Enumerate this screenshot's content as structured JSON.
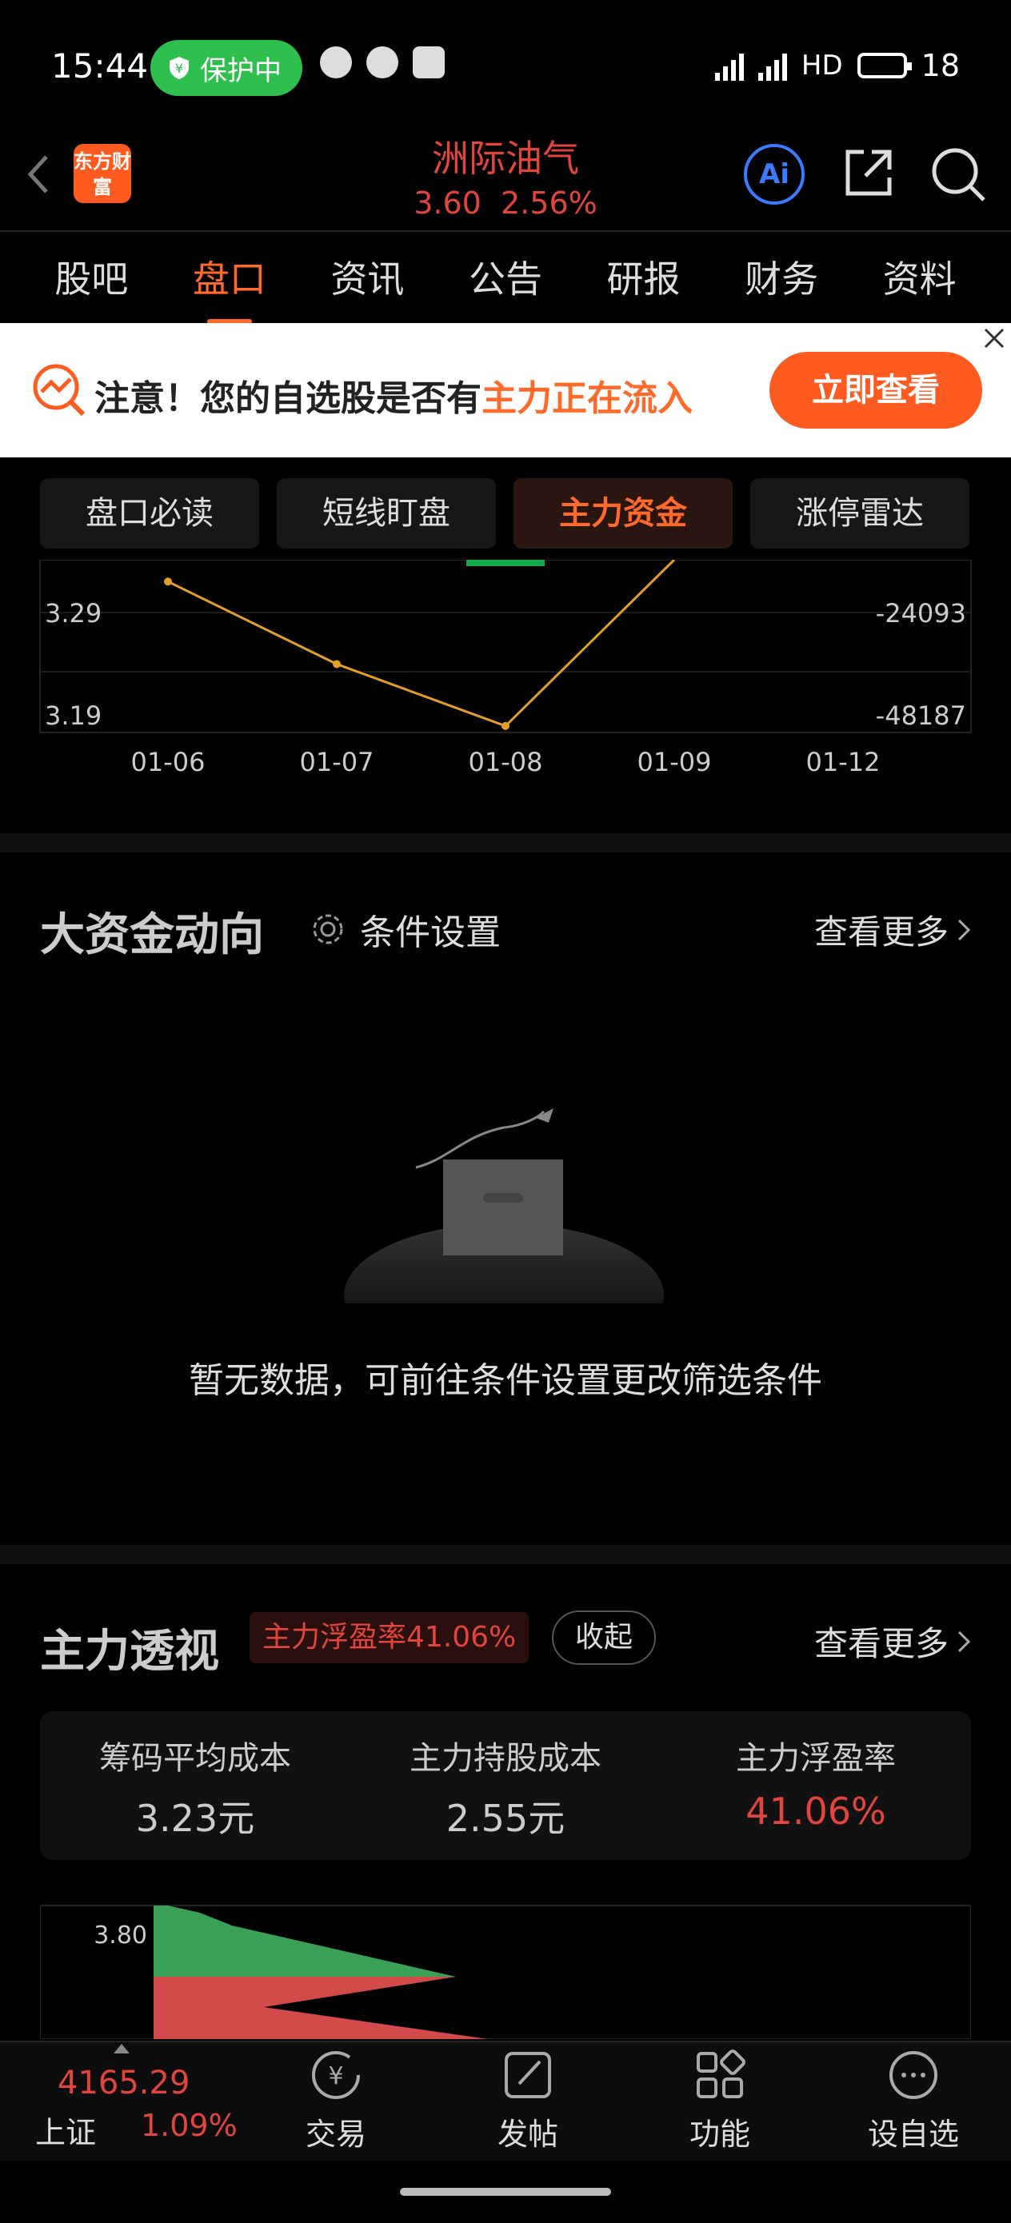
{
  "status_bar": {
    "time": "15:44",
    "protect": "保护中",
    "network": "4G 5G HD",
    "battery": "18"
  },
  "header": {
    "logo": "东方财富",
    "title": "洲际油气",
    "price": "3.60",
    "change_pct": "2.56%",
    "ai": "Ai"
  },
  "tabs": [
    "股吧",
    "盘口",
    "资讯",
    "公告",
    "研报",
    "财务",
    "资料"
  ],
  "active_tab": "盘口",
  "banner": {
    "prefix": "注意！您的自选股是否有",
    "highlight": "主力正在流入",
    "button": "立即查看"
  },
  "sub_tabs": [
    "盘口必读",
    "短线盯盘",
    "主力资金",
    "涨停雷达"
  ],
  "active_sub_tab": "主力资金",
  "chart_data": {
    "type": "line",
    "x": [
      "01-06",
      "01-07",
      "01-08",
      "01-09",
      "01-12"
    ],
    "y_left_ticks": [
      "3.29",
      "3.19"
    ],
    "y_right_ticks": [
      "-24093",
      "-48187"
    ],
    "series": [
      {
        "values": [
          3.32,
          3.24,
          3.18,
          3.36,
          null
        ]
      }
    ],
    "colors": {
      "line": "#e3a025",
      "bar": "#14a84e"
    }
  },
  "big_fund": {
    "title": "大资金动向",
    "settings": "条件设置",
    "more": "查看更多",
    "empty": "暂无数据，可前往条件设置更改筛选条件"
  },
  "main_view": {
    "title": "主力透视",
    "badge": "主力浮盈率41.06%",
    "collapse": "收起",
    "more": "查看更多",
    "stats": [
      {
        "label": "筹码平均成本",
        "value": "3.23元"
      },
      {
        "label": "主力持股成本",
        "value": "2.55元"
      },
      {
        "label": "主力浮盈率",
        "value": "41.06%"
      }
    ],
    "dist_tick": "3.80"
  },
  "bottom_nav": {
    "index_value": "4165.29",
    "index_name": "上证",
    "index_pct": "1.09%",
    "items": [
      "交易",
      "发帖",
      "功能",
      "设自选"
    ]
  },
  "colors": {
    "accent": "#ff6a2b",
    "up": "#e2453c",
    "green": "#3aa055"
  }
}
